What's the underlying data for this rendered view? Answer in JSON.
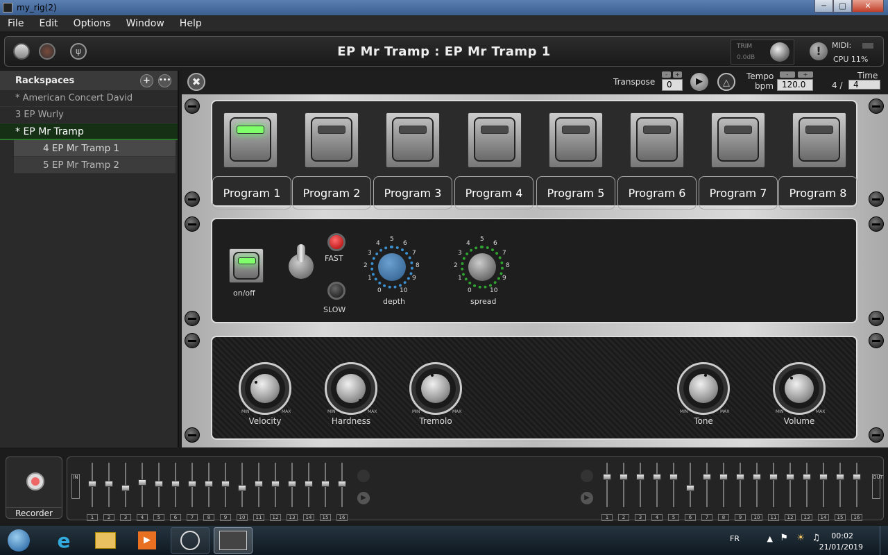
{
  "window": {
    "title": "my_rig(2)"
  },
  "menu": [
    "File",
    "Edit",
    "Options",
    "Window",
    "Help"
  ],
  "header": {
    "rack_title": "EP Mr Tramp : EP Mr Tramp 1",
    "trim_label": "TRIM",
    "trim_value": "0.0dB",
    "midi_label": "MIDI:",
    "cpu_label": "CPU  11%"
  },
  "sidebar": {
    "title": "Rackspaces",
    "rackspaces": [
      "* American Concert David",
      "3 EP Wurly",
      "* EP Mr Tramp"
    ],
    "variations": [
      "4  EP Mr Tramp 1",
      "5  EP Mr Tramp 2"
    ]
  },
  "toolbar": {
    "transpose_label": "Transpose",
    "transpose_value": "0",
    "tempo_label": "Tempo",
    "bpm_label": "bpm",
    "tempo_value": "120.0",
    "time_label": "Time",
    "time_num": "4 /",
    "time_den": "4"
  },
  "programs": [
    "Program 1",
    "Program 2",
    "Program 3",
    "Program 4",
    "Program 5",
    "Program 6",
    "Program 7",
    "Program 8"
  ],
  "active_program_led": 1,
  "tremolo": {
    "onoff_label": "on/off",
    "fast_label": "FAST",
    "slow_label": "SLOW",
    "depth_label": "depth",
    "spread_label": "spread",
    "scale": [
      "0",
      "1",
      "2",
      "3",
      "4",
      "5",
      "6",
      "7",
      "8",
      "9",
      "10"
    ]
  },
  "knobs": {
    "labels": [
      "Velocity",
      "Hardness",
      "Tremolo",
      "Tone",
      "Volume"
    ],
    "min": "MIN",
    "max": "MAX"
  },
  "recorder": {
    "label": "Recorder"
  },
  "mixer": {
    "in_label": "IN",
    "out_label": "OUT",
    "channels": [
      "1",
      "2",
      "3",
      "4",
      "5",
      "6",
      "7",
      "8",
      "9",
      "10",
      "11",
      "12",
      "13",
      "14",
      "15",
      "16"
    ]
  },
  "taskbar": {
    "lang": "FR",
    "time": "00:02",
    "date": "21/01/2019"
  },
  "colors": {
    "led_green": "#7fff6a",
    "led_red": "#cc1111",
    "depth_ring": "#3a8fd0",
    "spread_ring": "#2fa12f"
  }
}
